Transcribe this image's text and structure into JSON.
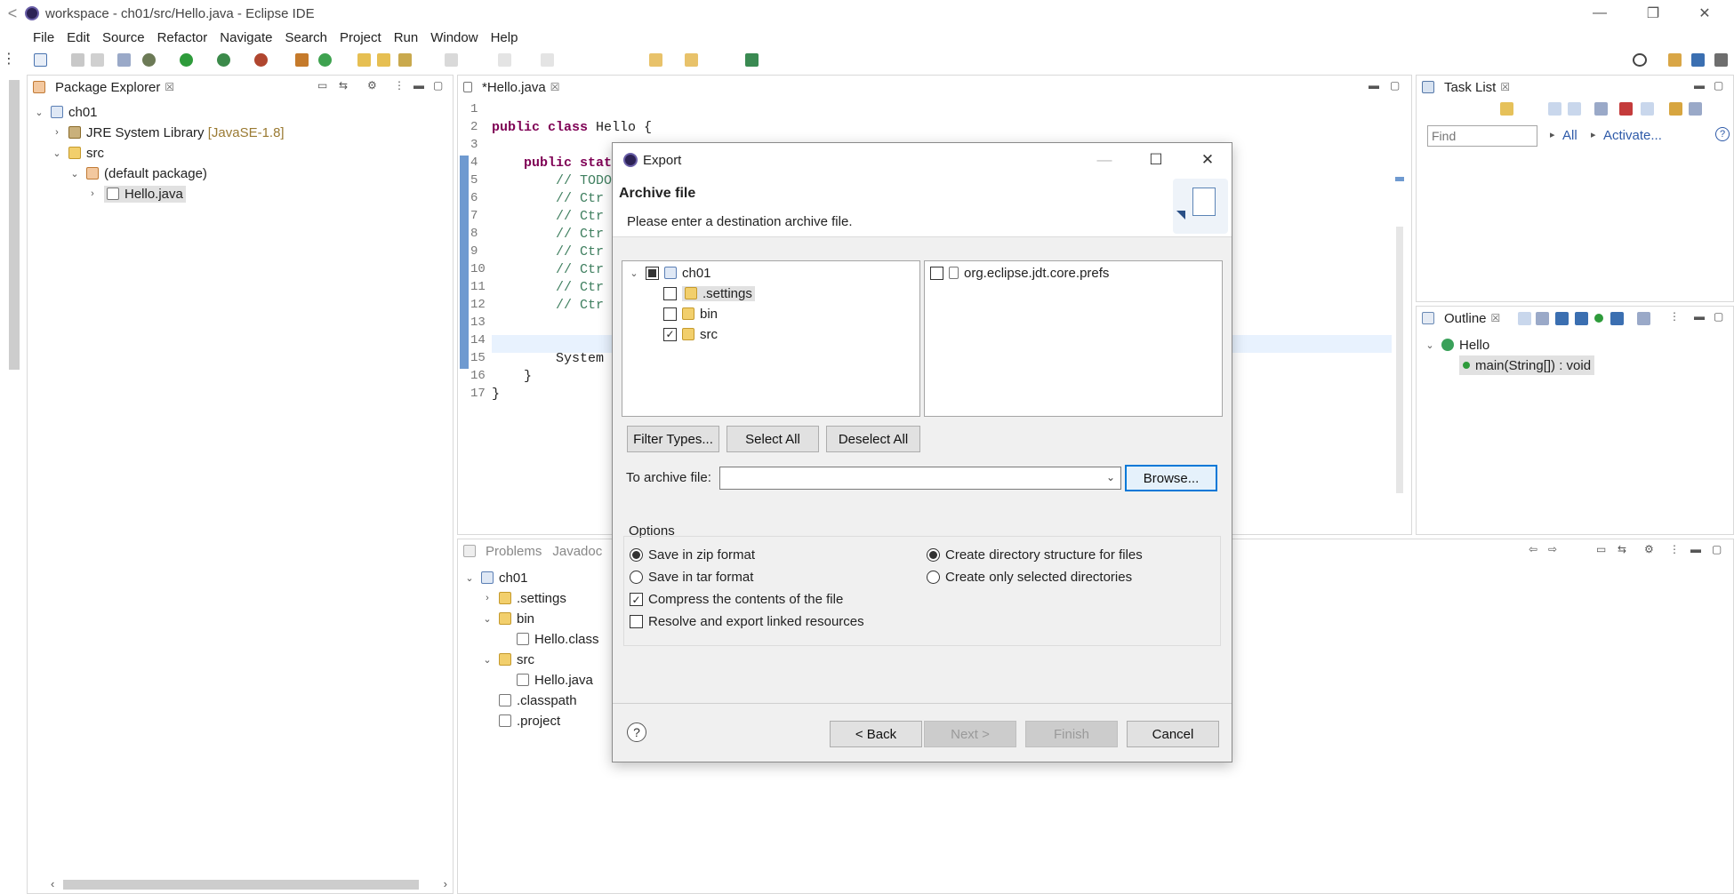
{
  "window": {
    "title": "workspace - ch01/src/Hello.java - Eclipse IDE",
    "back_glyph": "<",
    "min": "—",
    "max": "❐",
    "close": "✕"
  },
  "menu": [
    "File",
    "Edit",
    "Source",
    "Refactor",
    "Navigate",
    "Search",
    "Project",
    "Run",
    "Window",
    "Help"
  ],
  "package_explorer": {
    "title": "Package Explorer",
    "items": [
      {
        "label": "ch01",
        "extra": ""
      },
      {
        "label": "JRE System Library",
        "extra": "[JavaSE-1.8]"
      },
      {
        "label": "src",
        "extra": ""
      },
      {
        "label": "(default package)",
        "extra": ""
      },
      {
        "label": "Hello.java",
        "extra": ""
      }
    ]
  },
  "editor": {
    "tab": "*Hello.java",
    "lines": [
      "1",
      "2",
      "3",
      "4",
      "5",
      "6",
      "7",
      "8",
      "9",
      "10",
      "11",
      "12",
      "13",
      "14",
      "15",
      "16",
      "17"
    ],
    "code": {
      "l2a": "public class",
      "l2b": " Hello {",
      "l4a": "public stat",
      "l5": "// TODO",
      "l6": "// Ctr",
      "l7": "// Ctr",
      "l8": "// Ctr",
      "l9": "// Ctr",
      "l10": "// Ctr",
      "l11": "// Ctr",
      "l12": "// Ctr",
      "l14": "System",
      "l15": "}",
      "l16": "}"
    }
  },
  "task_list": {
    "title": "Task List",
    "find_placeholder": "Find",
    "all": "All",
    "activate": "Activate..."
  },
  "outline": {
    "title": "Outline",
    "class": "Hello",
    "method": "main(String[]) : void"
  },
  "bottom": {
    "tabs": [
      "Problems",
      "Javadoc"
    ],
    "tree": [
      {
        "label": "ch01"
      },
      {
        "label": ".settings"
      },
      {
        "label": "bin"
      },
      {
        "label": "Hello.class"
      },
      {
        "label": "src"
      },
      {
        "label": "Hello.java"
      },
      {
        "label": ".classpath"
      },
      {
        "label": ".project"
      }
    ]
  },
  "dialog": {
    "title": "Export",
    "heading": "Archive file",
    "subtitle": "Please enter a destination archive file.",
    "left_tree": [
      {
        "label": "ch01"
      },
      {
        "label": ".settings"
      },
      {
        "label": "bin"
      },
      {
        "label": "src"
      }
    ],
    "right_list": [
      {
        "label": "org.eclipse.jdt.core.prefs"
      }
    ],
    "filter_types": "Filter Types...",
    "select_all": "Select All",
    "deselect_all": "Deselect All",
    "archive_label": "To archive file:",
    "archive_value": "",
    "browse": "Browse...",
    "options_label": "Options",
    "opts": {
      "zip": "Save in zip format",
      "tar": "Save in tar format",
      "compress": "Compress the contents of the file",
      "resolve": "Resolve and export linked resources",
      "dirstruct": "Create directory structure for files",
      "selected": "Create only selected directories"
    },
    "back": "< Back",
    "next": "Next >",
    "finish": "Finish",
    "cancel": "Cancel",
    "help": "?"
  }
}
